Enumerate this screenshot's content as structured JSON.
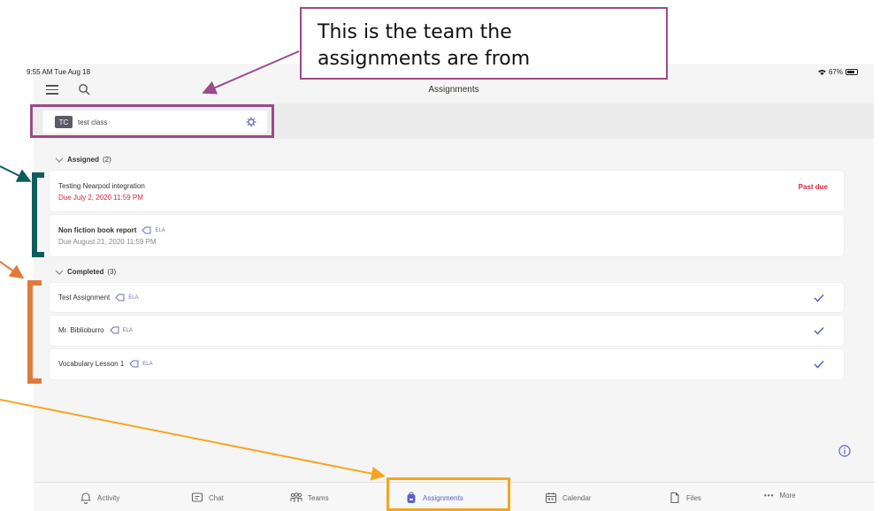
{
  "status_bar": {
    "time": "9:55 AM Tue Aug 18",
    "battery": "67%"
  },
  "header": {
    "title": "Assignments"
  },
  "team": {
    "initials": "TC",
    "name": "test class"
  },
  "assigned": {
    "label": "Assigned",
    "count": "(2)",
    "items": [
      {
        "title": "Testing Nearpod integration",
        "due": "Due July 2, 2020 11:59 PM",
        "status": "Past due"
      },
      {
        "title": "Non fiction book report",
        "tag": "ELA",
        "due": "Due August 21, 2020 11:59 PM"
      }
    ]
  },
  "completed": {
    "label": "Completed",
    "count": "(3)",
    "items": [
      {
        "title": "Test Assignment",
        "tag": "ELA"
      },
      {
        "title": "Mr. Bibliobur​ro",
        "tag": "ELA"
      },
      {
        "title": "Vocabulary Lesson 1",
        "tag": "ELA"
      }
    ]
  },
  "tabs": [
    "Activity",
    "Chat",
    "Teams",
    "Assignments",
    "Calendar",
    "Files",
    "More"
  ],
  "callout": {
    "line1": "This is the team the",
    "line2": "assignments are from"
  },
  "colors": {
    "accent": "#5b5fc7",
    "past_due": "#d7263d",
    "callout_border": "#9b4a8a",
    "bracket_green": "#0f5c5c",
    "bracket_orange": "#e07b3b",
    "highlight_tab": "#f6a51f"
  }
}
